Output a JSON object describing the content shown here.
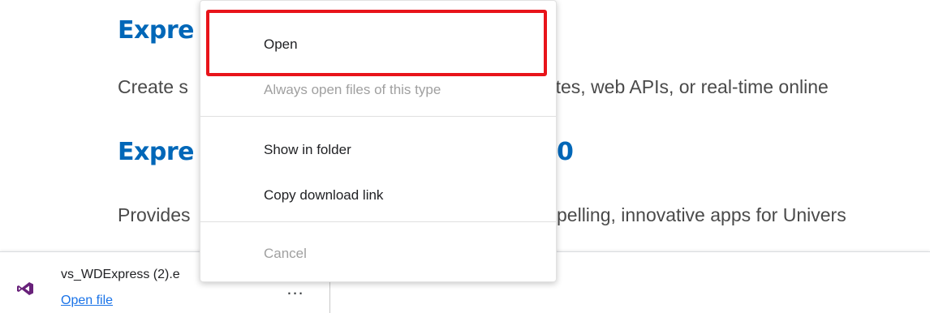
{
  "page": {
    "headings": [
      "Expre",
      "Expre"
    ],
    "heading2_tail": "0",
    "desc1_left": "Create s",
    "desc1_right": "sites, web APIs, or real-time online",
    "desc2_left": "Provides",
    "desc2_right": "pelling, innovative apps for Univers"
  },
  "download": {
    "icon": "visual-studio-icon",
    "filename": "vs_WDExpress (2).e",
    "link": "Open file",
    "more": "..."
  },
  "context_menu": {
    "items": [
      {
        "label": "Open",
        "enabled": true
      },
      {
        "label": "Always open files of this type",
        "enabled": false
      },
      {
        "label": "Show in folder",
        "enabled": true
      },
      {
        "label": "Copy download link",
        "enabled": true
      },
      {
        "label": "Cancel",
        "enabled": false
      }
    ]
  },
  "colors": {
    "heading": "#0067b8",
    "highlight": "#e8141a",
    "link": "#1a73e8",
    "disabled": "#a0a0a0"
  }
}
